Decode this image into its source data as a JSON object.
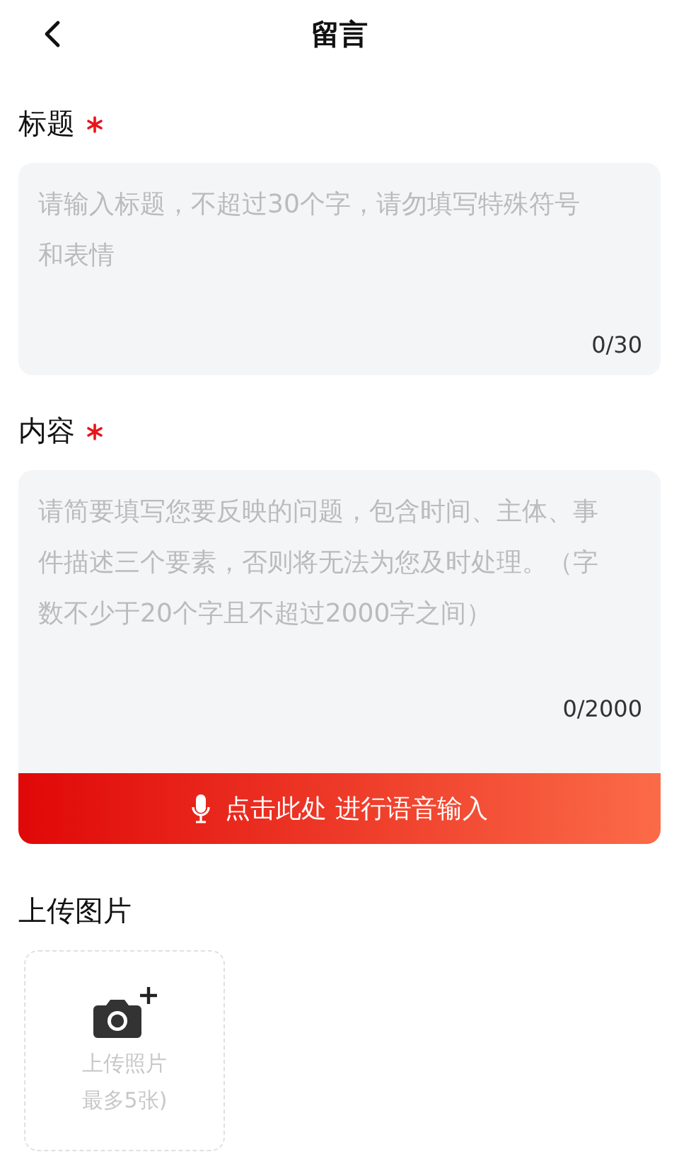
{
  "header": {
    "title": "留言"
  },
  "fields": [
    {
      "label": "标题",
      "required": true,
      "placeholder": "请输入标题，不超过30个字，请勿填写特殊符号和表情",
      "counter": "0/30",
      "kind": "short"
    },
    {
      "label": "内容",
      "required": true,
      "placeholder": "请简要填写您要反映的问题，包含时间、主体、事件描述三个要素，否则将无法为您及时处理。（字数不少于20个字且不超过2000字之间）",
      "counter": "0/2000",
      "kind": "long"
    }
  ],
  "voice_button": {
    "label": "点击此处 进行语音输入"
  },
  "upload": {
    "label": "上传图片",
    "tile_lines": [
      "上传照片",
      "最多5张)"
    ]
  }
}
